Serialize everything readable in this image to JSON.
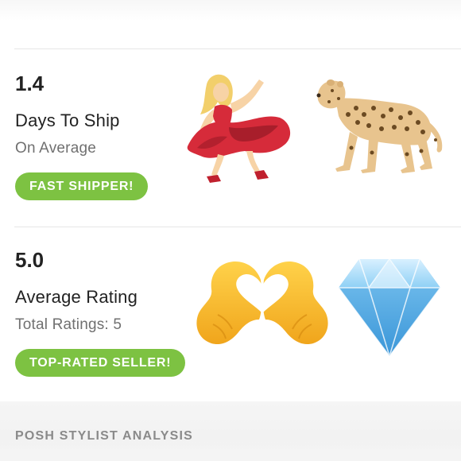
{
  "shipping": {
    "value": "1.4",
    "title": "Days To Ship",
    "subtitle": "On Average",
    "badge": "FAST SHIPPER!"
  },
  "rating": {
    "value": "5.0",
    "title": "Average Rating",
    "subtitle": "Total Ratings: 5",
    "badge": "TOP-RATED SELLER!"
  },
  "next_section": {
    "label": "POSH STYLIST ANALYSIS"
  },
  "emojis": [
    "dancer-icon",
    "leopard-icon",
    "heart-hands-icon",
    "diamond-icon"
  ],
  "colors": {
    "badge_green": "#7dc242",
    "text_dark": "#222222",
    "text_muted": "#707070",
    "section_label": "#8a8a8a"
  }
}
